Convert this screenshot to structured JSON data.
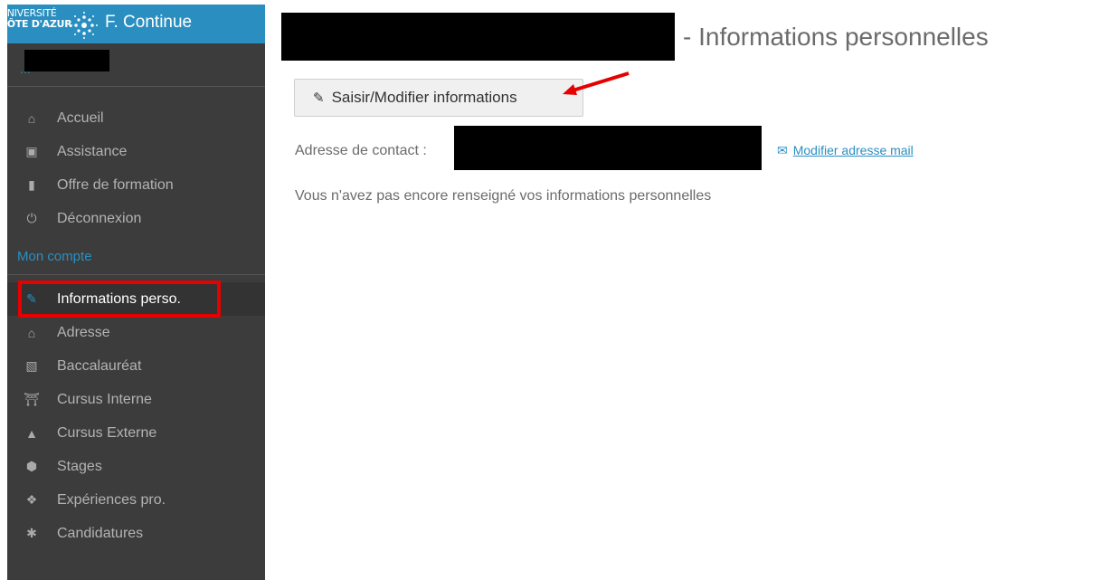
{
  "brand": {
    "logo_line1": "UNIVERSITÉ",
    "logo_line2": "CÔTE D'AZUR",
    "title": "F. Continue",
    "accent_color": "#2a8fc0"
  },
  "user": {
    "id_partial": "…"
  },
  "nav": [
    {
      "label": "Accueil",
      "icon": "home-icon"
    },
    {
      "label": "Assistance",
      "icon": "ambulance-icon"
    },
    {
      "label": "Offre de formation",
      "icon": "bookmark-icon"
    },
    {
      "label": "Déconnexion",
      "icon": "power-icon"
    }
  ],
  "account": {
    "section_title": "Mon compte",
    "items": [
      {
        "label": "Informations perso.",
        "icon": "pencil-icon",
        "active": true
      },
      {
        "label": "Adresse",
        "icon": "home-icon"
      },
      {
        "label": "Baccalauréat",
        "icon": "book-icon"
      },
      {
        "label": "Cursus Interne",
        "icon": "institution-icon"
      },
      {
        "label": "Cursus Externe",
        "icon": "graduation-cap-icon"
      },
      {
        "label": "Stages",
        "icon": "cube-icon"
      },
      {
        "label": "Expériences pro.",
        "icon": "cubes-icon"
      },
      {
        "label": "Candidatures",
        "icon": "asterisk-icon"
      }
    ]
  },
  "main": {
    "title": "- Informations personnelles",
    "edit_button": "Saisir/Modifier informations",
    "contact_label": "Adresse de contact :",
    "mail_link": "Modifier adresse mail",
    "info_text": "Vous n'avez pas encore renseigné vos informations personnelles"
  }
}
